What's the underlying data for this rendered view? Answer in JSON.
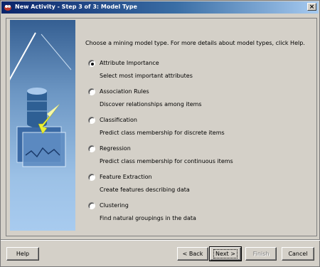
{
  "window": {
    "title": "New Activity - Step 3 of 3: Model Type",
    "close_glyph": "×"
  },
  "main": {
    "intro": "Choose a mining model type.  For more details about model types, click Help.",
    "selected_option": "attribute_importance",
    "options": [
      {
        "label": "Attribute Importance",
        "description": "Select most important attributes",
        "selected": true
      },
      {
        "label": "Association Rules",
        "description": "Discover relationships among items",
        "selected": false
      },
      {
        "label": "Classification",
        "description": "Predict class membership for discrete items",
        "selected": false
      },
      {
        "label": "Regression",
        "description": "Predict class membership for continuous items",
        "selected": false
      },
      {
        "label": "Feature Extraction",
        "description": "Create features describing data",
        "selected": false
      },
      {
        "label": "Clustering",
        "description": "Find natural groupings in the data",
        "selected": false
      }
    ]
  },
  "footer": {
    "help_label": "Help",
    "back_label": "< Back",
    "next_label": "Next >",
    "finish_label": "Finish",
    "cancel_label": "Cancel"
  },
  "colors": {
    "titlebar_start": "#0a246a",
    "titlebar_end": "#a6caf0",
    "face": "#d4d0c8",
    "side_panel": "#6d97c4"
  }
}
